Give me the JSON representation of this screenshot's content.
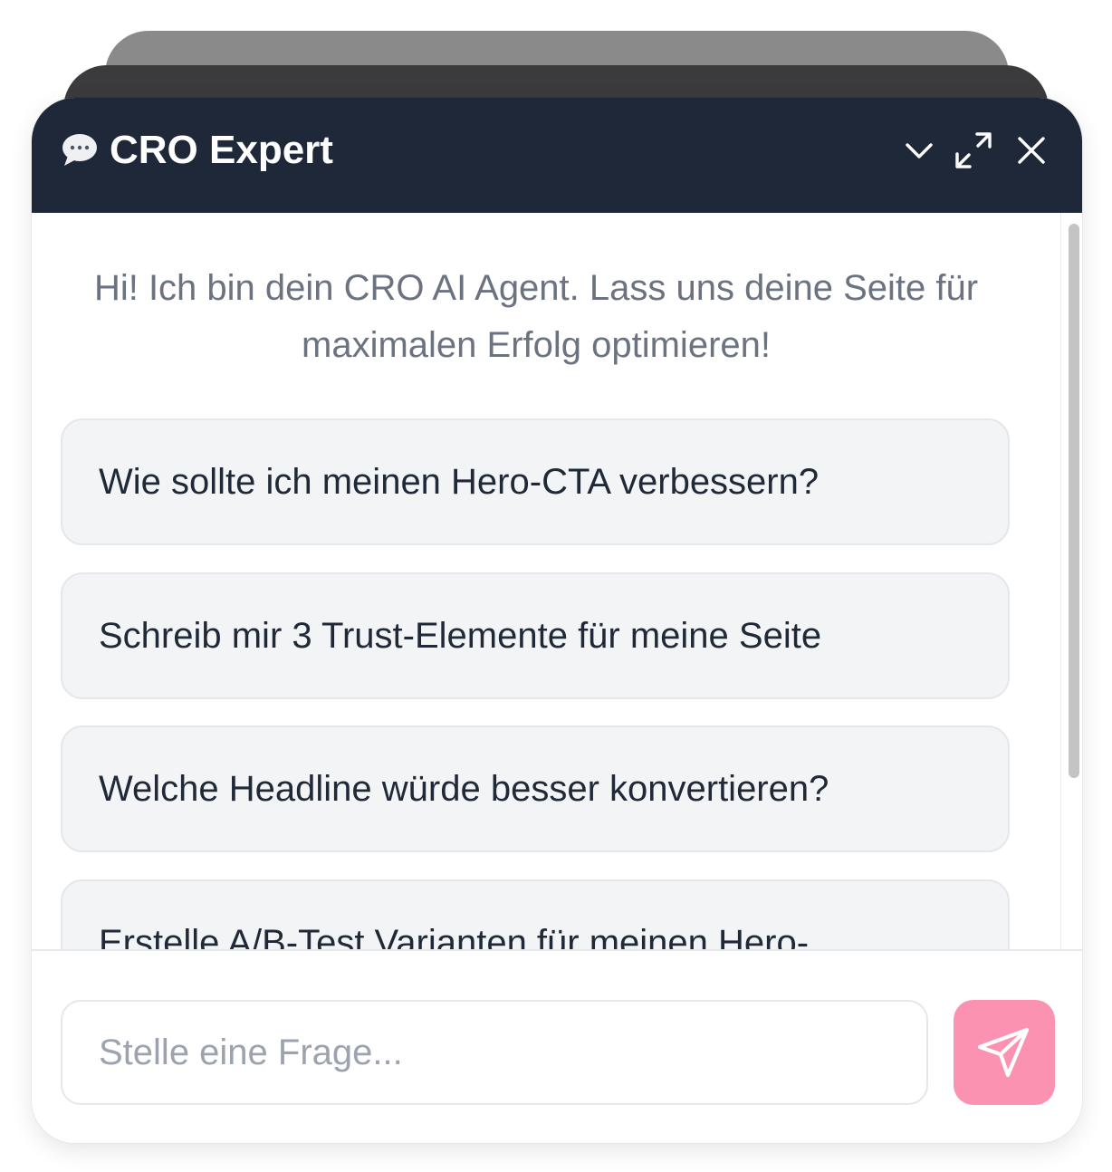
{
  "header": {
    "title": "CRO Expert",
    "icon": "speech-bubble-icon",
    "actions": [
      {
        "name": "collapse",
        "icon": "chevron-down-icon"
      },
      {
        "name": "expand",
        "icon": "expand-arrows-icon"
      },
      {
        "name": "close",
        "icon": "close-icon"
      }
    ]
  },
  "messages": {
    "greeting": "Hi! Ich bin dein CRO AI Agent. Lass uns deine Seite für maximalen Erfolg optimieren!",
    "suggestions": [
      {
        "label": "Wie sollte ich meinen Hero-CTA verbessern?"
      },
      {
        "label": "Schreib mir 3 Trust-Elemente für meine Seite"
      },
      {
        "label": "Welche Headline würde besser konvertieren?"
      },
      {
        "label": "Erstelle A/B-Test Varianten für meinen Hero-"
      }
    ]
  },
  "composer": {
    "placeholder": "Stelle eine Frage...",
    "value": "",
    "send_icon": "send-icon"
  },
  "colors": {
    "header_bg": "#1e2838",
    "accent": "#fc92b2",
    "chip_bg": "#f3f4f6",
    "greeting_text": "#6b7280"
  }
}
